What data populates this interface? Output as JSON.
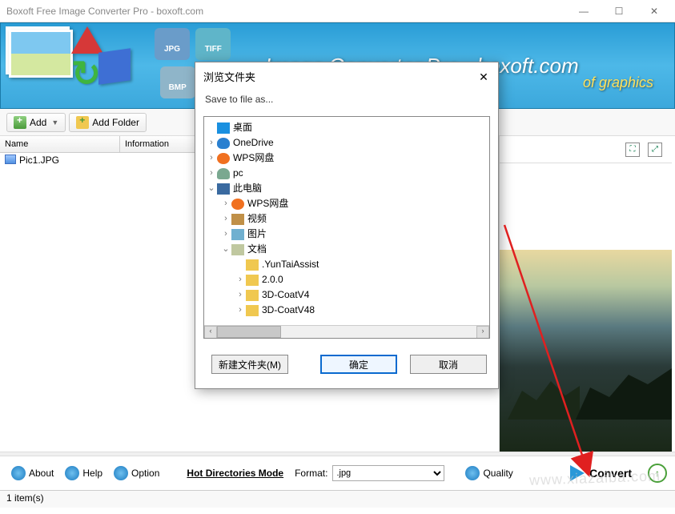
{
  "window": {
    "title": "Boxoft Free Image Converter Pro - boxoft.com"
  },
  "banner": {
    "title": "Image Converter Pro - boxoft.com",
    "subtitle": "of graphics",
    "badges": [
      "JPG",
      "TIFF",
      "BMP"
    ]
  },
  "toolbar": {
    "add": "Add",
    "add_folder": "Add Folder"
  },
  "list": {
    "col_name": "Name",
    "col_info": "Information",
    "rows": [
      {
        "name": "Pic1.JPG"
      }
    ]
  },
  "bottom": {
    "about": "About",
    "help": "Help",
    "option": "Option",
    "mode": "Hot Directories Mode",
    "format_label": "Format:",
    "format_value": ".jpg",
    "quality": "Quality",
    "convert": "Convert"
  },
  "status": {
    "text": "1 item(s)"
  },
  "dialog": {
    "title": "浏览文件夹",
    "subtitle": "Save to file as...",
    "tree": {
      "desktop": "桌面",
      "onedrive": "OneDrive",
      "wps": "WPS网盘",
      "pc_user": "pc",
      "this_pc": "此电脑",
      "wps2": "WPS网盘",
      "video": "视频",
      "pictures": "图片",
      "documents": "文档",
      "f1": ".YunTaiAssist",
      "f2": "2.0.0",
      "f3": "3D-CoatV4",
      "f4": "3D-CoatV48"
    },
    "new_folder": "新建文件夹(M)",
    "ok": "确定",
    "cancel": "取消"
  },
  "watermark": "www.xiazaiba.com"
}
